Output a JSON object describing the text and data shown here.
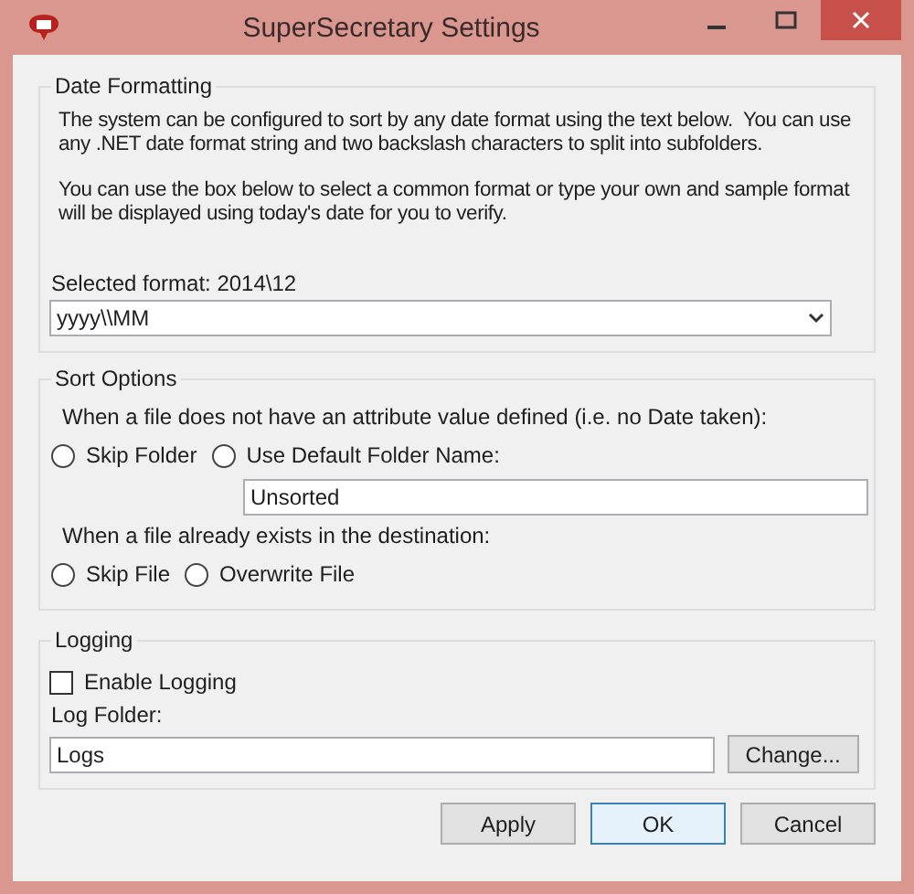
{
  "window": {
    "title": "SuperSecretary Settings"
  },
  "date_formatting": {
    "title": "Date Formatting",
    "description": [
      "The system can be configured to sort by any date format using the text below.  You can use any .NET date format string and two backslash characters to split into subfolders.",
      "You can use the box below to select a common format or type your own and sample format will be displayed using today's date for you to verify."
    ],
    "selected_format_label": "Selected format: 2014\\12",
    "format_value": "yyyy\\\\MM"
  },
  "sort_options": {
    "title": "Sort Options",
    "missing_attribute_label": "When a file does not have an attribute value defined (i.e. no Date taken):",
    "missing_attribute_options": [
      {
        "label": "Skip Folder",
        "selected": false
      },
      {
        "label": "Use Default Folder Name:",
        "selected": false
      }
    ],
    "default_folder_name": "Unsorted",
    "existing_file_label": "When a file already exists in the destination:",
    "existing_file_options": [
      {
        "label": "Skip File",
        "selected": false
      },
      {
        "label": "Overwrite File",
        "selected": false
      }
    ]
  },
  "logging": {
    "title": "Logging",
    "enable_logging": {
      "label": "Enable Logging",
      "checked": false
    },
    "log_folder_label": "Log Folder:",
    "log_folder_value": "Logs",
    "change_button": "Change..."
  },
  "buttons": [
    {
      "label": "Apply",
      "default": false
    },
    {
      "label": "OK",
      "default": true
    },
    {
      "label": "Cancel",
      "default": false
    }
  ]
}
